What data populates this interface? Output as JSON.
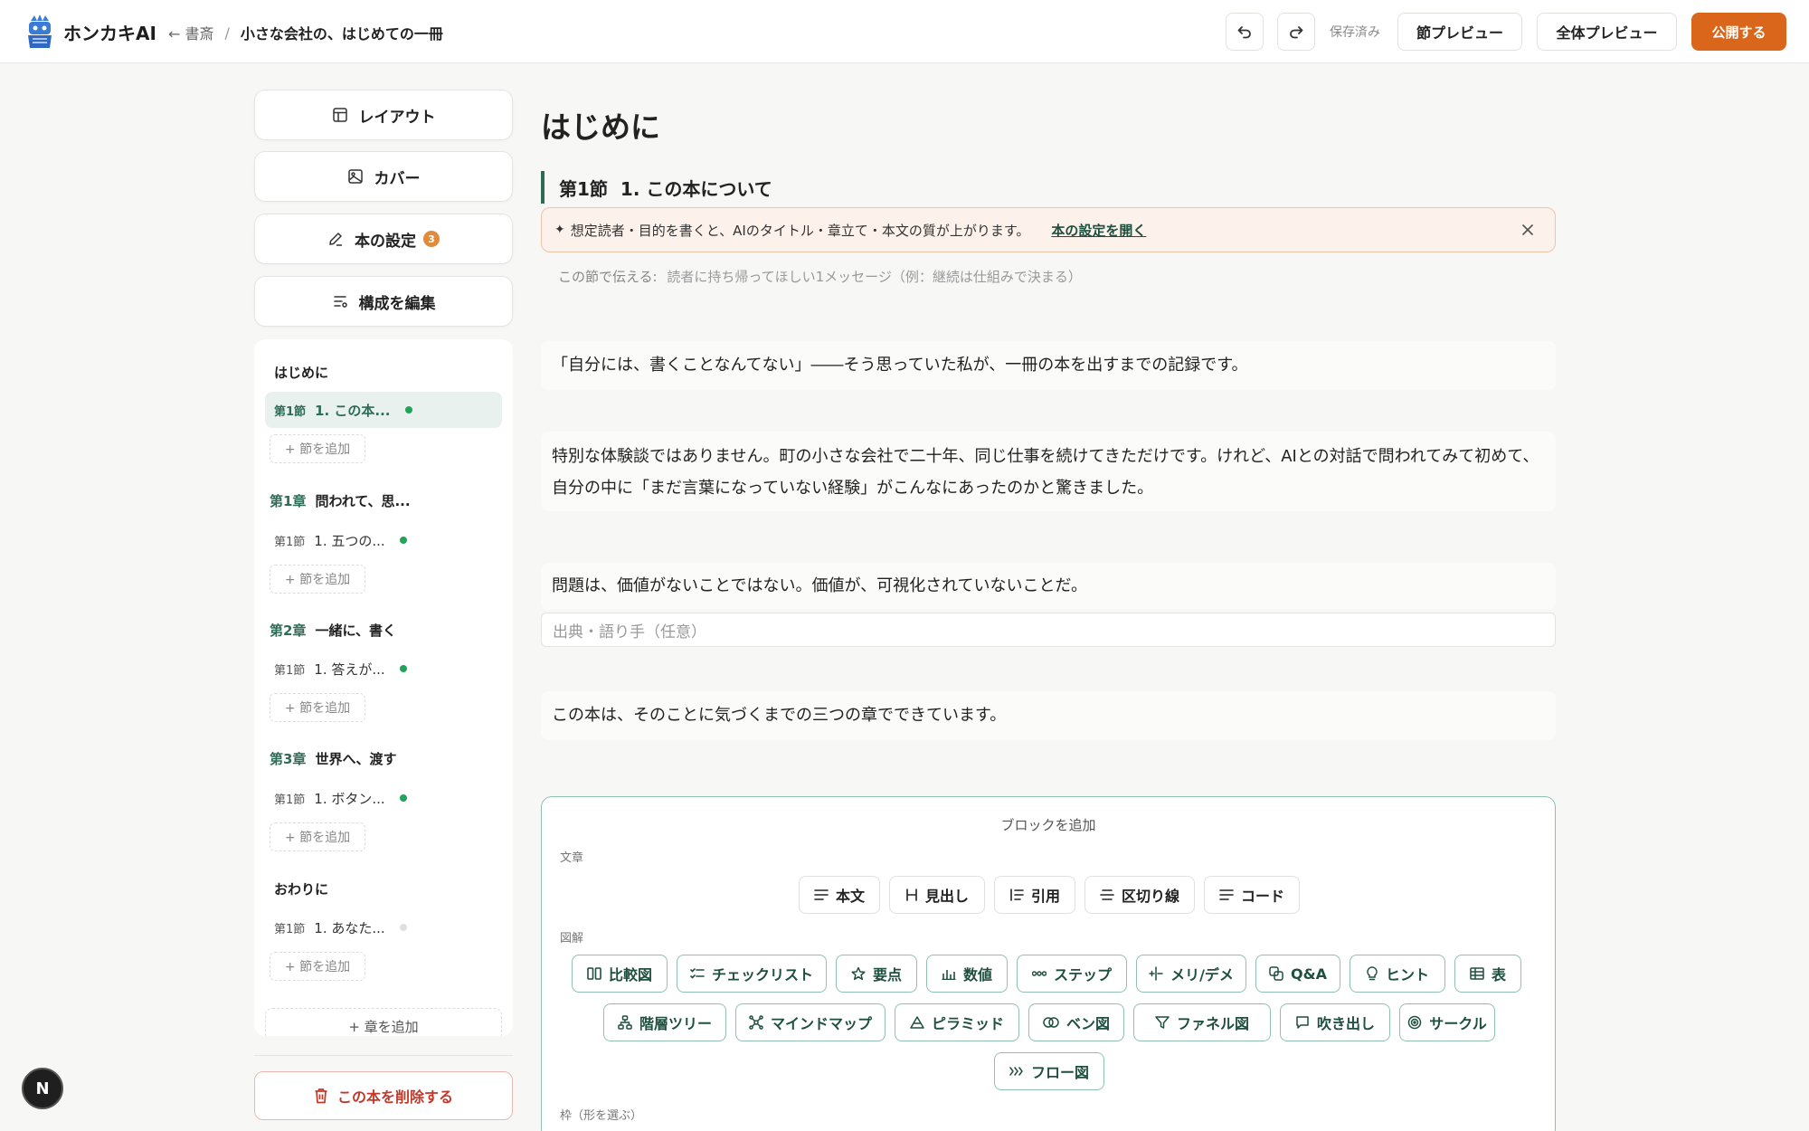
{
  "header": {
    "app_name": "ホンカキAI",
    "back_label": "← 書斎",
    "separator": "/",
    "book_title": "小さな会社の、はじめての一冊",
    "saved_label": "保存済み",
    "section_preview_label": "節プレビュー",
    "full_preview_label": "全体プレビュー",
    "publish_label": "公開する"
  },
  "sidebar": {
    "layout_label": "レイアウト",
    "cover_label": "カバー",
    "settings_label": "本の設定",
    "settings_badge": "3",
    "edit_structure_label": "構成を編集",
    "groups": [
      {
        "chapter": "",
        "title": "はじめに",
        "item_sec": "第1節",
        "item_title": "1. この本...",
        "status": "done"
      },
      {
        "chapter": "第1章",
        "title": "問われて、思...",
        "item_sec": "第1節",
        "item_title": "1. 五つの...",
        "status": "done"
      },
      {
        "chapter": "第2章",
        "title": "一緒に、書く",
        "item_sec": "第1節",
        "item_title": "1. 答えが...",
        "status": "done"
      },
      {
        "chapter": "第3章",
        "title": "世界へ、渡す",
        "item_sec": "第1節",
        "item_title": "1. ボタン...",
        "status": "done"
      },
      {
        "chapter": "",
        "title": "おわりに",
        "item_sec": "第1節",
        "item_title": "1. あなた...",
        "status": "empty"
      }
    ],
    "add_section_label": "+ 節を追加",
    "add_chapter_label": "+ 章を追加",
    "delete_label": "この本を削除する"
  },
  "main": {
    "page_title": "はじめに",
    "section_num": "第1節",
    "section_title": "1. この本について",
    "notice_text": "想定読者・目的を書くと、AIのタイトル・章立て・本文の質が上がります。",
    "notice_link": "本の設定を開く",
    "convey_label": "この節で伝える:",
    "convey_placeholder": "読者に持ち帰ってほしい1メッセージ（例：継続は仕組みで決まる）",
    "para1": "「自分には、書くことなんてない」――そう思っていた私が、一冊の本を出すまでの記録です。",
    "para2": "特別な体験談ではありません。町の小さな会社で二十年、同じ仕事を続けてきただけです。けれど、AIとの対話で問われてみて初めて、自分の中に「まだ言葉になっていない経験」がこんなにあったのかと驚きました。",
    "quote": "問題は、価値がないことではない。価値が、可視化されていないことだ。",
    "quote_source_placeholder": "出典・語り手（任意）",
    "para3": "この本は、そのことに気づくまでの三つの章でできています。"
  },
  "add_block": {
    "title": "ブロックを追加",
    "cat_text": "文章",
    "cat_diagram": "図解",
    "cat_frame": "枠（形を選ぶ）",
    "text_blocks": [
      "本文",
      "見出し",
      "引用",
      "区切り線",
      "コード"
    ],
    "diagram_row1": [
      "比較図",
      "チェックリスト",
      "要点",
      "数値",
      "ステップ",
      "メリ/デメ",
      "Q&A",
      "ヒント",
      "表"
    ],
    "diagram_row2": [
      "階層ツリー",
      "マインドマップ",
      "ピラミッド",
      "ベン図",
      "ファネル図",
      "吹き出し",
      "サークル"
    ],
    "diagram_row3": [
      "フロー図"
    ]
  },
  "colors": {
    "accent": "#2f6b57",
    "publish": "#d9661a",
    "danger": "#c0392b",
    "notice_bg": "#fdf1ec"
  },
  "dev_badge": "N"
}
